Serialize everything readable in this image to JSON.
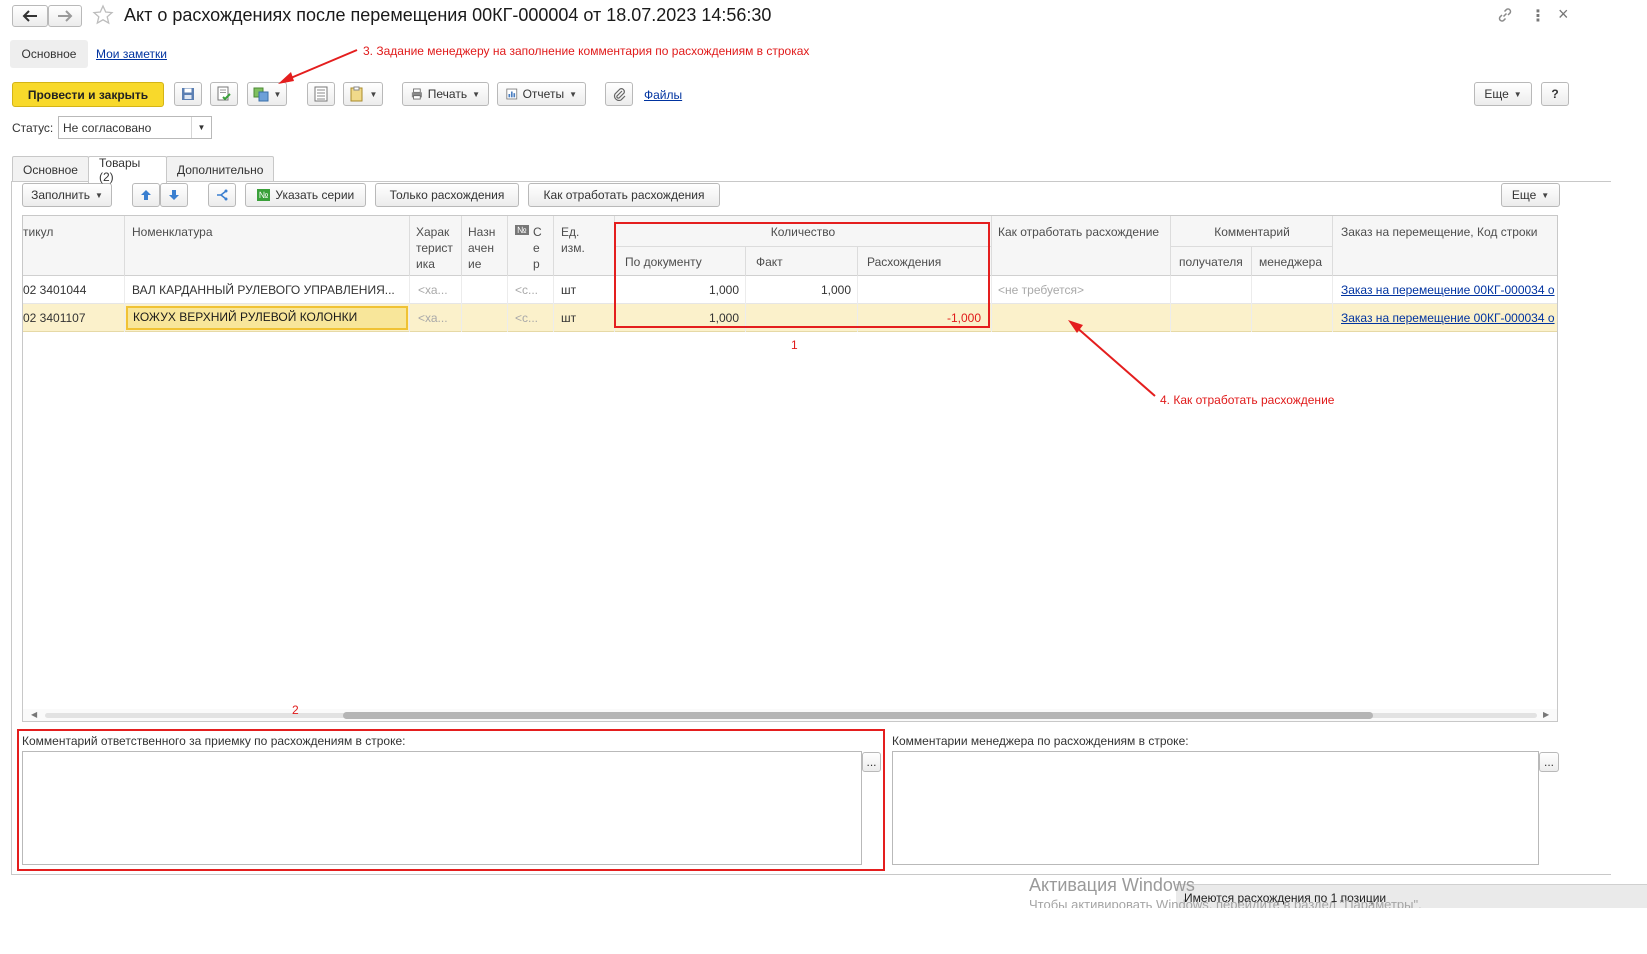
{
  "window": {
    "title": "Акт о расхождениях после перемещения 00КГ-000004 от 18.07.2023 14:56:30"
  },
  "nav": {
    "main_label": "Основное",
    "notes_label": "Мои заметки"
  },
  "toolbar": {
    "post_close_label": "Провести и закрыть",
    "print_label": "Печать",
    "reports_label": "Отчеты",
    "files_label": "Файлы",
    "more_label": "Еще",
    "help_label": "?"
  },
  "status": {
    "label": "Статус:",
    "value": "Не согласовано"
  },
  "tabs": [
    {
      "label": "Основное"
    },
    {
      "label": "Товары (2)"
    },
    {
      "label": "Дополнительно"
    }
  ],
  "table_toolbar": {
    "fill_label": "Заполнить",
    "series_label": "Указать серии",
    "only_diff_label": "Только расхождения",
    "how_process_label": "Как отработать расхождения",
    "more_label": "Еще"
  },
  "table": {
    "headers": {
      "article": "тикул",
      "nomenclature": "Номенклатура",
      "characteristic": "Харак терист ика",
      "purpose": "Назн ачен ие",
      "series": "С е р",
      "series_icon": "№",
      "unit": "Ед. изм.",
      "quantity": "Количество",
      "by_doc": "По документу",
      "fact": "Факт",
      "diff": "Расхождения",
      "how_process": "Как отработать расхождение",
      "comment": "Комментарий",
      "recipient": "получателя",
      "manager": "менеджера",
      "order": "Заказ на перемещение, Код строки"
    },
    "rows": [
      {
        "article": "02 3401044",
        "nomenclature": "ВАЛ КАРДАННЫЙ РУЛЕВОГО УПРАВЛЕНИЯ...",
        "characteristic": "<ха...",
        "series": "<с...",
        "unit": "шт",
        "by_doc": "1,000",
        "fact": "1,000",
        "diff": "",
        "how_process": "<не требуется>",
        "order": "Заказ на перемещение 00КГ-000034 о"
      },
      {
        "article": "02 3401107",
        "nomenclature": "КОЖУХ ВЕРХНИЙ РУЛЕВОЙ КОЛОНКИ",
        "characteristic": "<ха...",
        "series": "<с...",
        "unit": "шт",
        "by_doc": "1,000",
        "fact": "",
        "diff": "-1,000",
        "how_process": "",
        "order": "Заказ на перемещение 00КГ-000034 о"
      }
    ]
  },
  "comments": {
    "receiver_label": "Комментарий ответственного за приемку по расхождениям в строке:",
    "manager_label": "Комментарии менеджера по расхождениям в строке:",
    "receiver_value": "",
    "manager_value": "",
    "ellipsis": "..."
  },
  "annotations": {
    "a1": "1",
    "a2": "2",
    "a3": "3. Задание менеджеру на заполнение комментария по расхождениям в строках",
    "a4": "4. Как отработать расхождение"
  },
  "footer": {
    "status_message": "Имеются расхождения по 1 позиции",
    "watermark_title": "Активация Windows",
    "watermark_sub": "Чтобы активировать Windows, перейдите в раздел \"Параметры\"."
  },
  "colors": {
    "accent_yellow": "#f8d92b",
    "selected_row": "#fbf1cb",
    "annotation_red": "#e41e1e",
    "link_blue": "#0033a0"
  }
}
